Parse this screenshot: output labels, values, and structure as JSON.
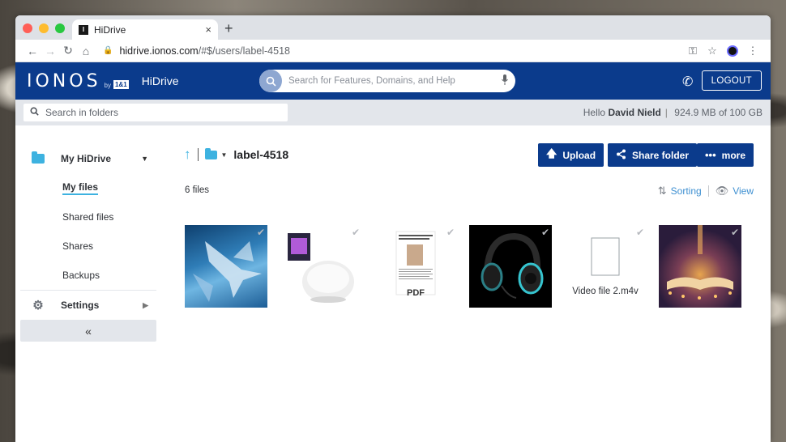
{
  "browser": {
    "tab_title": "HiDrive",
    "tab_favicon": "I",
    "tab_close": "×",
    "new_tab": "+",
    "url_host": "hidrive.ionos.com",
    "url_path": "/#$/users/label-4518"
  },
  "header": {
    "logo": "IONOS",
    "logo_by": "by",
    "logo_badge": "1&1",
    "app_name": "HiDrive",
    "search_placeholder": "Search for Features, Domains, and Help",
    "logout_label": "LOGOUT",
    "accent": "#0b3b8c"
  },
  "subbar": {
    "folder_search_placeholder": "Search in folders",
    "greeting": "Hello",
    "user_name": "David Nield",
    "storage_text": "924.9 MB of 100 GB"
  },
  "sidebar": {
    "my_hidrive": "My HiDrive",
    "items": [
      {
        "label": "My files"
      },
      {
        "label": "Shared files"
      },
      {
        "label": "Shares"
      },
      {
        "label": "Backups"
      }
    ],
    "settings": "Settings",
    "collapse": "«"
  },
  "main": {
    "folder_name": "label-4518",
    "buttons": {
      "upload": "Upload",
      "share_folder": "Share folder",
      "more": "more"
    },
    "files_count": "6 files",
    "sorting_label": "Sorting",
    "view_label": "View",
    "files": [
      {
        "type": "image",
        "icon": "shark-photo"
      },
      {
        "type": "image",
        "icon": "lamp-photo"
      },
      {
        "type": "pdf",
        "label": "PDF"
      },
      {
        "type": "image",
        "icon": "headphones-photo"
      },
      {
        "type": "video",
        "label": "Video file 2.m4v"
      },
      {
        "type": "image",
        "icon": "book-photo"
      }
    ]
  }
}
